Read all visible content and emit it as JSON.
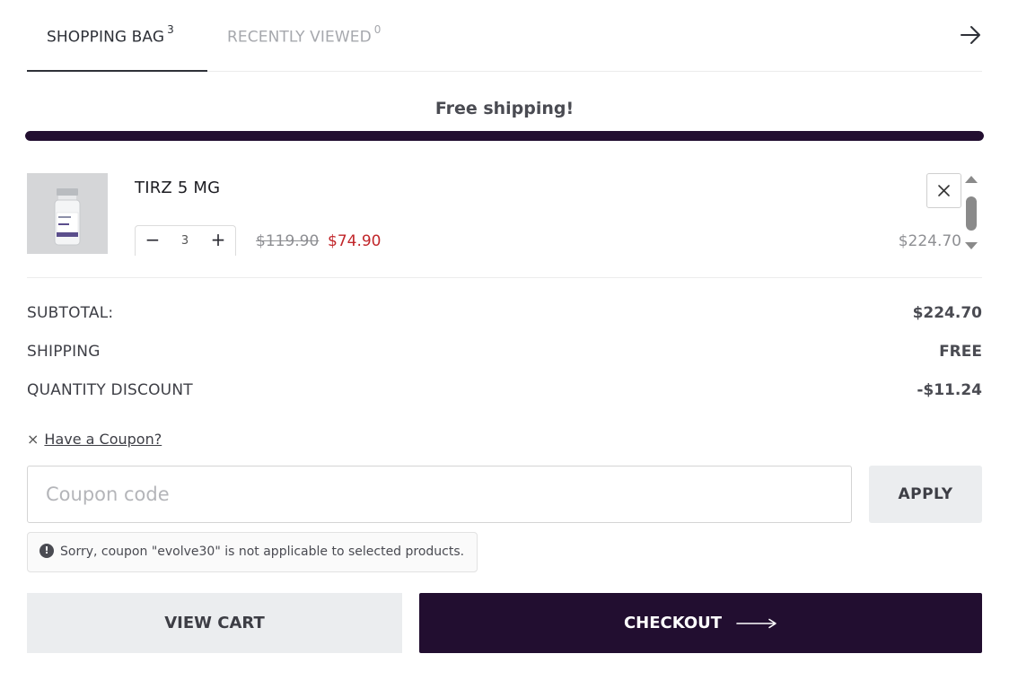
{
  "tabs": {
    "bag_label": "SHOPPING BAG",
    "bag_count": "3",
    "viewed_label": "RECENTLY VIEWED",
    "viewed_count": "0"
  },
  "shipping": {
    "label": "Free shipping!",
    "progress_percent": 100
  },
  "item": {
    "name": "TIRZ 5 MG",
    "quantity": "3",
    "original_price": "$119.90",
    "sale_price": "$74.90",
    "line_total": "$224.70"
  },
  "summary": {
    "subtotal_label": "SUBTOTAL:",
    "subtotal_value": "$224.70",
    "shipping_label": "SHIPPING",
    "shipping_value": "FREE",
    "discount_label": "QUANTITY DISCOUNT",
    "discount_value": "-$11.24"
  },
  "coupon": {
    "close_glyph": "×",
    "link_label": "Have a Coupon?",
    "placeholder": "Coupon code",
    "value": "",
    "apply_label": "APPLY",
    "notice": "Sorry, coupon \"evolve30\" is not applicable to selected products."
  },
  "actions": {
    "view_cart_label": "VIEW CART",
    "checkout_label": "CHECKOUT"
  },
  "colors": {
    "brand": "#220e30",
    "sale_price": "#c1262a",
    "button_gray": "#ebedef"
  },
  "icons": {
    "tab_arrow": "arrow-right-icon",
    "remove": "close-icon",
    "notice": "exclamation-circle-icon",
    "checkout_arrow": "long-arrow-right-icon"
  }
}
